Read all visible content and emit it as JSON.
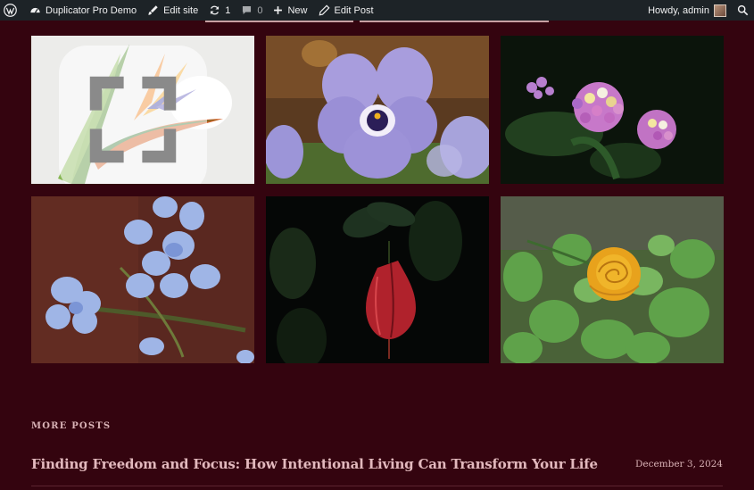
{
  "adminbar": {
    "wp_logo_icon": "wordpress-icon",
    "site_name": "Duplicator Pro Demo",
    "edit_site": "Edit site",
    "updates_count": "1",
    "comments_count": "0",
    "new_label": "New",
    "edit_post": "Edit Post",
    "greeting": "Howdy, admin"
  },
  "gallery": {
    "images": [
      {
        "subject": "bird-of-paradise flower"
      },
      {
        "subject": "purple pansy"
      },
      {
        "subject": "lantana cluster"
      },
      {
        "subject": "blue plumbago"
      },
      {
        "subject": "red bud"
      },
      {
        "subject": "yellow rose"
      }
    ]
  },
  "more_posts": {
    "heading": "MORE POSTS",
    "posts": [
      {
        "title": "Finding Freedom and Focus: How Intentional Living Can Transform Your Life",
        "date": "December 3, 2024"
      }
    ]
  },
  "colors": {
    "background": "#34040f",
    "adminbar": "#1d2327",
    "accent_text": "#e2b9bd"
  }
}
